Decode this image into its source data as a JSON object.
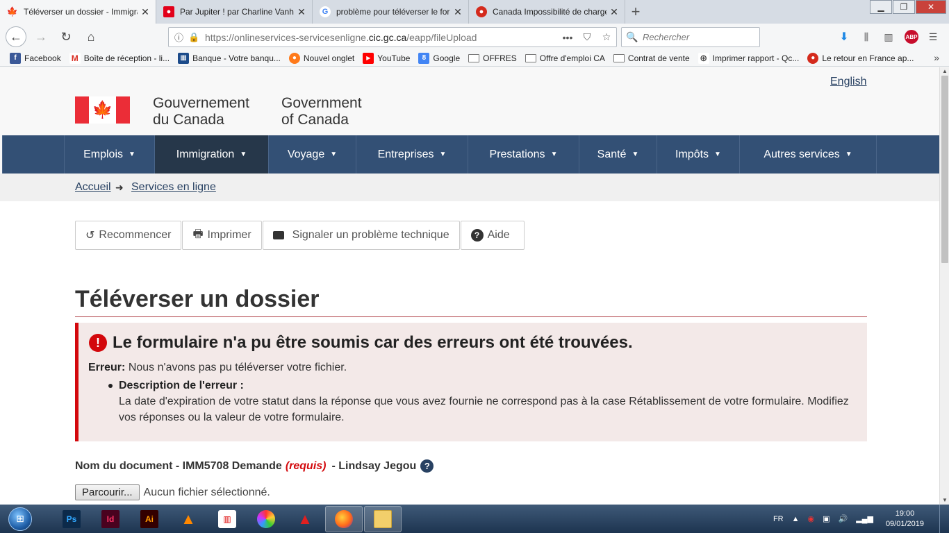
{
  "browser": {
    "tabs": [
      {
        "title": "Téléverser un dossier - Immigra",
        "active": true
      },
      {
        "title": "Par Jupiter ! par Charline Vanho",
        "active": false
      },
      {
        "title": "problème pour téléverser le for",
        "active": false
      },
      {
        "title": "Canada Impossibilité de charge",
        "active": false
      }
    ],
    "url_prefix": "https://onlineservices-servicesenligne.",
    "url_domain": "cic.gc.ca",
    "url_path": "/eapp/fileUpload",
    "search_placeholder": "Rechercher",
    "bookmarks": [
      {
        "label": "Facebook"
      },
      {
        "label": "Boîte de réception - li..."
      },
      {
        "label": "Banque - Votre banqu..."
      },
      {
        "label": "Nouvel onglet"
      },
      {
        "label": "YouTube"
      },
      {
        "label": "Google"
      },
      {
        "label": "OFFRES"
      },
      {
        "label": "Offre d'emploi CA"
      },
      {
        "label": "Contrat de vente"
      },
      {
        "label": "Imprimer rapport - Qc..."
      },
      {
        "label": "Le retour en France ap..."
      }
    ]
  },
  "header": {
    "lang_link": "English",
    "gov_fr_line1": "Gouvernement",
    "gov_fr_line2": "du Canada",
    "gov_en_line1": "Government",
    "gov_en_line2": "of Canada"
  },
  "menu": [
    {
      "label": "Emplois"
    },
    {
      "label": "Immigration"
    },
    {
      "label": "Voyage"
    },
    {
      "label": "Entreprises"
    },
    {
      "label": "Prestations"
    },
    {
      "label": "Santé"
    },
    {
      "label": "Impôts"
    },
    {
      "label": "Autres services"
    }
  ],
  "breadcrumb": {
    "home": "Accueil",
    "current": "Services en ligne"
  },
  "toolbar": {
    "restart": "Recommencer",
    "print": "Imprimer",
    "report": "Signaler un problème technique",
    "help": "Aide"
  },
  "page_title": "Téléverser un dossier",
  "error": {
    "heading": "Le formulaire n'a pu être soumis car des erreurs ont été trouvées.",
    "label": "Erreur:",
    "message": "Nous n'avons pas pu téléverser votre fichier.",
    "desc_title": "Description de l'erreur :",
    "desc_text": "La date d'expiration de votre statut dans la réponse que vous avez fournie ne correspond pas à la case Rétablissement de votre formulaire. Modifiez vos réponses ou la valeur de votre formulaire."
  },
  "document": {
    "label": "Nom du document - IMM5708 Demande",
    "required": "(requis)",
    "person": "- Lindsay Jegou",
    "browse_button": "Parcourir...",
    "no_file": "Aucun fichier sélectionné."
  },
  "taskbar": {
    "lang": "FR",
    "time": "19:00",
    "date": "09/01/2019"
  }
}
